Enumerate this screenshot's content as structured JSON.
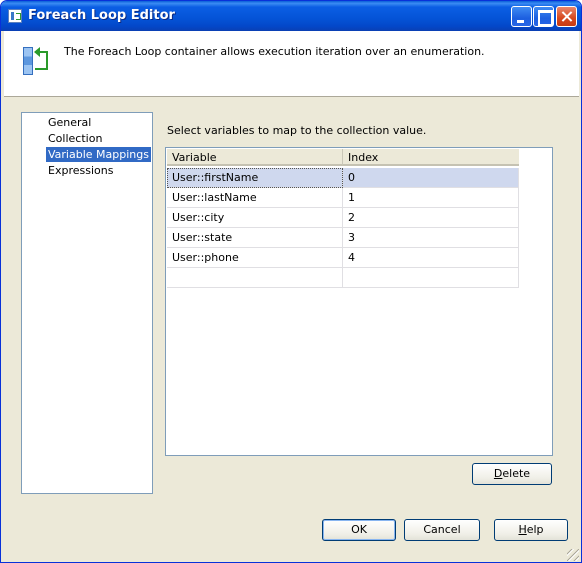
{
  "window": {
    "title": "Foreach Loop Editor"
  },
  "header": {
    "description": "The Foreach Loop container allows execution iteration over an enumeration.",
    "icon": "foreach-loop-icon"
  },
  "nav": {
    "items": [
      {
        "label": "General",
        "selected": false
      },
      {
        "label": "Collection",
        "selected": false
      },
      {
        "label": "Variable Mappings",
        "selected": true
      },
      {
        "label": "Expressions",
        "selected": false
      }
    ]
  },
  "mappings": {
    "instruction": "Select variables to map to the collection value.",
    "columns": [
      "Variable",
      "Index"
    ],
    "rows": [
      {
        "variable": "User::firstName",
        "index": "0"
      },
      {
        "variable": "User::lastName",
        "index": "1"
      },
      {
        "variable": "User::city",
        "index": "2"
      },
      {
        "variable": "User::state",
        "index": "3"
      },
      {
        "variable": "User::phone",
        "index": "4"
      }
    ]
  },
  "buttons": {
    "delete_pre": "",
    "delete_key": "D",
    "delete_post": "elete",
    "ok": "OK",
    "cancel": "Cancel",
    "help_key": "H",
    "help_post": "elp"
  },
  "colors": {
    "titlebar": "#0453d6",
    "selection": "#316ac5",
    "row_selection": "#cfd8ee"
  }
}
